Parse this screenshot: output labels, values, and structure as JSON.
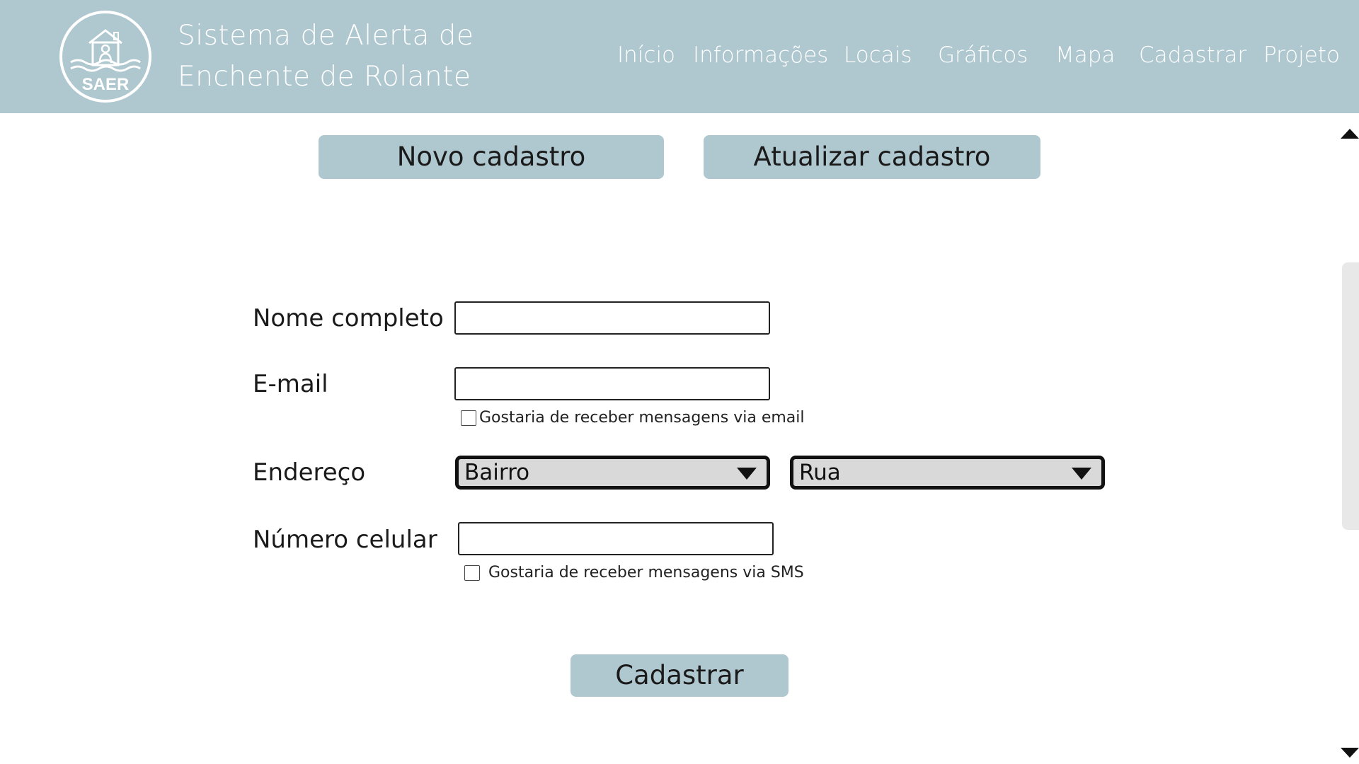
{
  "header": {
    "logo_text": "SAER",
    "title_line1": "Sistema de Alerta de",
    "title_line2": "Enchente de Rolante",
    "nav": [
      "Início",
      "Informações",
      "Locais",
      "Gráficos",
      "Mapa",
      "Cadastrar",
      "Projeto"
    ]
  },
  "tabs": {
    "new": "Novo cadastro",
    "update": "Atualizar cadastro"
  },
  "form": {
    "name_label": "Nome completo",
    "name_value": "",
    "email_label": "E-mail",
    "email_value": "",
    "email_opt_in": "Gostaria de receber mensagens via email",
    "address_label": "Endereço",
    "neighborhood_select": "Bairro",
    "street_select": "Rua",
    "phone_label": "Número celular",
    "phone_value": "",
    "sms_opt_in": "Gostaria de receber mensagens via SMS",
    "submit": "Cadastrar"
  },
  "icons": {
    "logo": "house-flood-icon",
    "select_arrow": "triangle-down-icon",
    "scroll_up": "triangle-up-icon",
    "scroll_down": "triangle-down-icon"
  },
  "colors": {
    "header_bg": "#afc7cf",
    "button_bg": "#afc7cf",
    "select_bg": "#d9d9d9"
  }
}
